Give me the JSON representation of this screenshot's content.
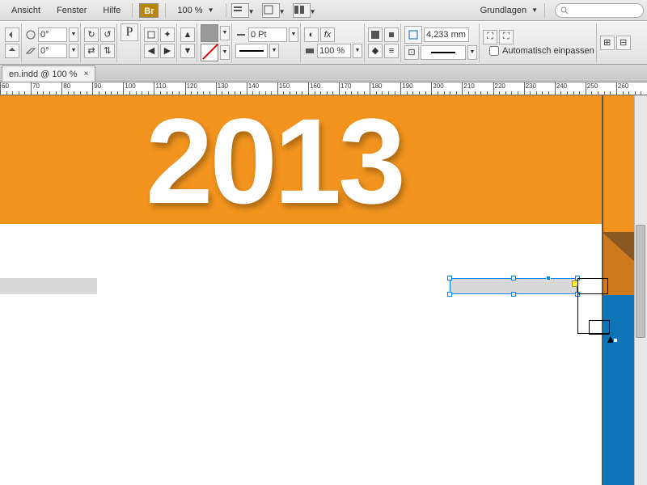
{
  "menu": {
    "ansicht": "Ansicht",
    "fenster": "Fenster",
    "hilfe": "Hilfe",
    "br": "Br",
    "zoom": "100 %",
    "workspace": "Grundlagen"
  },
  "toolbar": {
    "angle1": "0°",
    "angle2": "0°",
    "stroke_pt": "0 Pt",
    "percent": "100 %",
    "fit_val": "4,233 mm",
    "auto_fit": "Automatisch einpassen"
  },
  "tab": {
    "title": "en.indd @ 100 %"
  },
  "ruler": {
    "start": 60,
    "end": 260,
    "step": 10
  },
  "canvas": {
    "year": "2013"
  }
}
